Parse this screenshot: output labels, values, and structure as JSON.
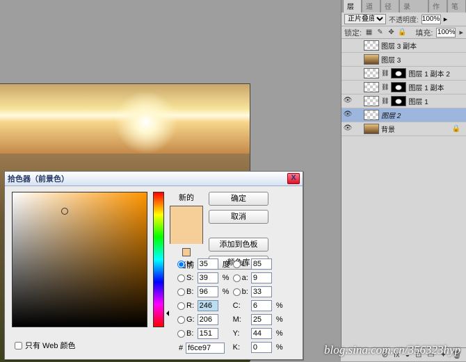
{
  "canvas": {},
  "picker": {
    "title": "拾色器（前景色）",
    "close": "X",
    "new_label": "新的",
    "current_label": "当前",
    "buttons": {
      "ok": "确定",
      "cancel": "取消",
      "add": "添加到色板",
      "lib": "颜色库"
    },
    "fields": {
      "H": {
        "v": "35",
        "u": "度"
      },
      "S": {
        "v": "39",
        "u": "%"
      },
      "Bv": {
        "v": "96",
        "u": "%"
      },
      "R": {
        "v": "246"
      },
      "G": {
        "v": "206"
      },
      "Bc": {
        "v": "151"
      },
      "L": {
        "v": "85"
      },
      "a": {
        "v": "9"
      },
      "b": {
        "v": "33"
      },
      "C": {
        "v": "6",
        "u": "%"
      },
      "M": {
        "v": "25",
        "u": "%"
      },
      "Y": {
        "v": "44",
        "u": "%"
      },
      "K": {
        "v": "0",
        "u": "%"
      }
    },
    "hex_label": "#",
    "hex": "f6ce97",
    "webonly": "只有 Web 颜色"
  },
  "panels": {
    "tabs": [
      "图层",
      "通道",
      "路径",
      "历史记录",
      "动作",
      "画笔"
    ],
    "blend_mode": "正片叠底",
    "opacity_label": "不透明度:",
    "opacity": "100%",
    "lock_label": "锁定:",
    "fill_label": "填充:",
    "fill": "100%",
    "layers": [
      {
        "visible": false,
        "name": "图层 3 副本",
        "mask": false,
        "thumb": "checker"
      },
      {
        "visible": false,
        "name": "图层 3",
        "mask": false,
        "thumb": "sunset"
      },
      {
        "visible": false,
        "name": "图层 1 副本 2",
        "mask": true,
        "thumb": "checker",
        "link": true
      },
      {
        "visible": false,
        "name": "图层 1 副本",
        "mask": true,
        "thumb": "checker",
        "link": true
      },
      {
        "visible": true,
        "name": "图层 1",
        "mask": true,
        "thumb": "checker",
        "link": true
      },
      {
        "visible": true,
        "name": "图层 2",
        "mask": false,
        "thumb": "checker",
        "selected": true
      },
      {
        "visible": true,
        "name": "背景",
        "mask": false,
        "thumb": "sunset",
        "locked": true
      }
    ],
    "footer_icons": [
      "⊘",
      "fx",
      "◒",
      "⊡",
      "▭",
      "✦",
      "🗑"
    ]
  },
  "watermark": "blog.sina.com.cn/356323hyp"
}
